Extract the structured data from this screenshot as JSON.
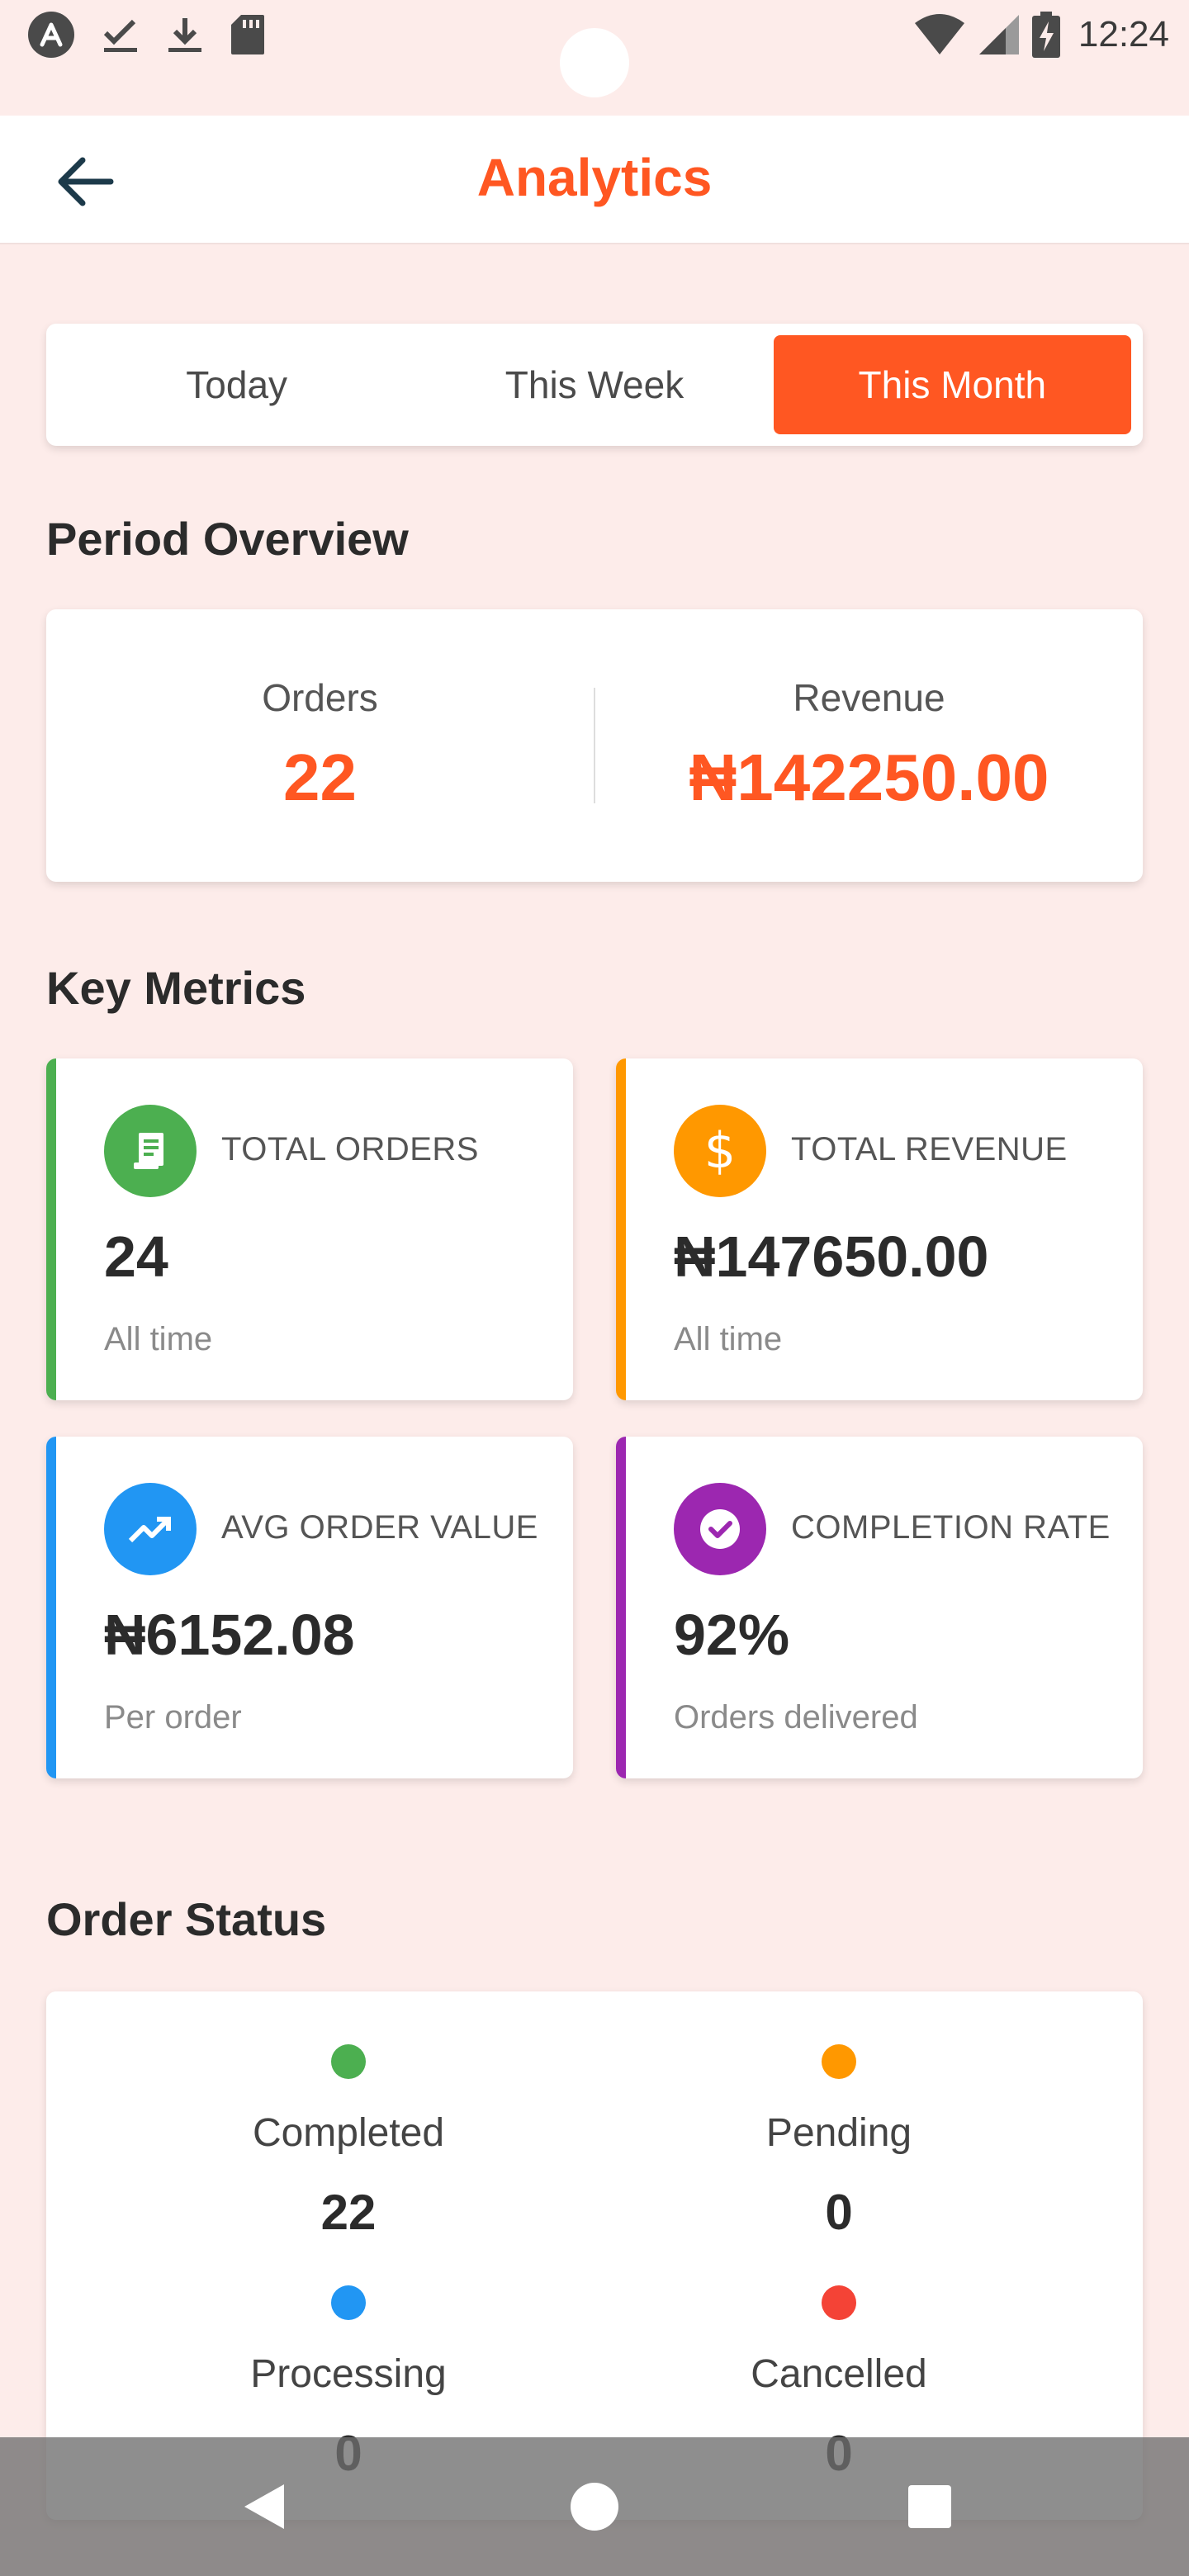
{
  "status_bar": {
    "time": "12:24",
    "left_icons": [
      "app-badge-icon",
      "check-download-icon",
      "download-icon",
      "sd-card-icon"
    ],
    "right_icons": [
      "wifi-icon",
      "signal-icon",
      "battery-charging-icon"
    ]
  },
  "app_bar": {
    "title": "Analytics",
    "back_icon": "arrow-left-icon"
  },
  "tabs": [
    {
      "label": "Today",
      "active": false
    },
    {
      "label": "This Week",
      "active": false
    },
    {
      "label": "This Month",
      "active": true
    }
  ],
  "period_overview": {
    "title": "Period Overview",
    "orders_label": "Orders",
    "orders_value": "22",
    "revenue_label": "Revenue",
    "revenue_value": "₦142250.00"
  },
  "key_metrics": {
    "title": "Key Metrics",
    "cards": [
      {
        "label": "TOTAL ORDERS",
        "value": "24",
        "sub": "All time",
        "color": "#4caf50",
        "icon": "receipt-icon"
      },
      {
        "label": "TOTAL REVENUE",
        "value": "₦147650.00",
        "sub": "All time",
        "color": "#ff9800",
        "icon": "dollar-icon"
      },
      {
        "label": "AVG ORDER VALUE",
        "value": "₦6152.08",
        "sub": "Per order",
        "color": "#2196f3",
        "icon": "trending-up-icon"
      },
      {
        "label": "COMPLETION RATE",
        "value": "92%",
        "sub": "Orders delivered",
        "color": "#9c27b0",
        "icon": "check-circle-icon"
      }
    ]
  },
  "order_status": {
    "title": "Order Status",
    "items": [
      {
        "label": "Completed",
        "count": "22",
        "color": "#4caf50"
      },
      {
        "label": "Pending",
        "count": "0",
        "color": "#ff9800"
      },
      {
        "label": "Processing",
        "count": "0",
        "color": "#2196f3"
      },
      {
        "label": "Cancelled",
        "count": "0",
        "color": "#f44336"
      }
    ]
  },
  "colors": {
    "accent": "#ff5722",
    "background": "#fdecea"
  },
  "nav_bar": {
    "icons": [
      "back-triangle-icon",
      "home-circle-icon",
      "recents-square-icon"
    ]
  }
}
